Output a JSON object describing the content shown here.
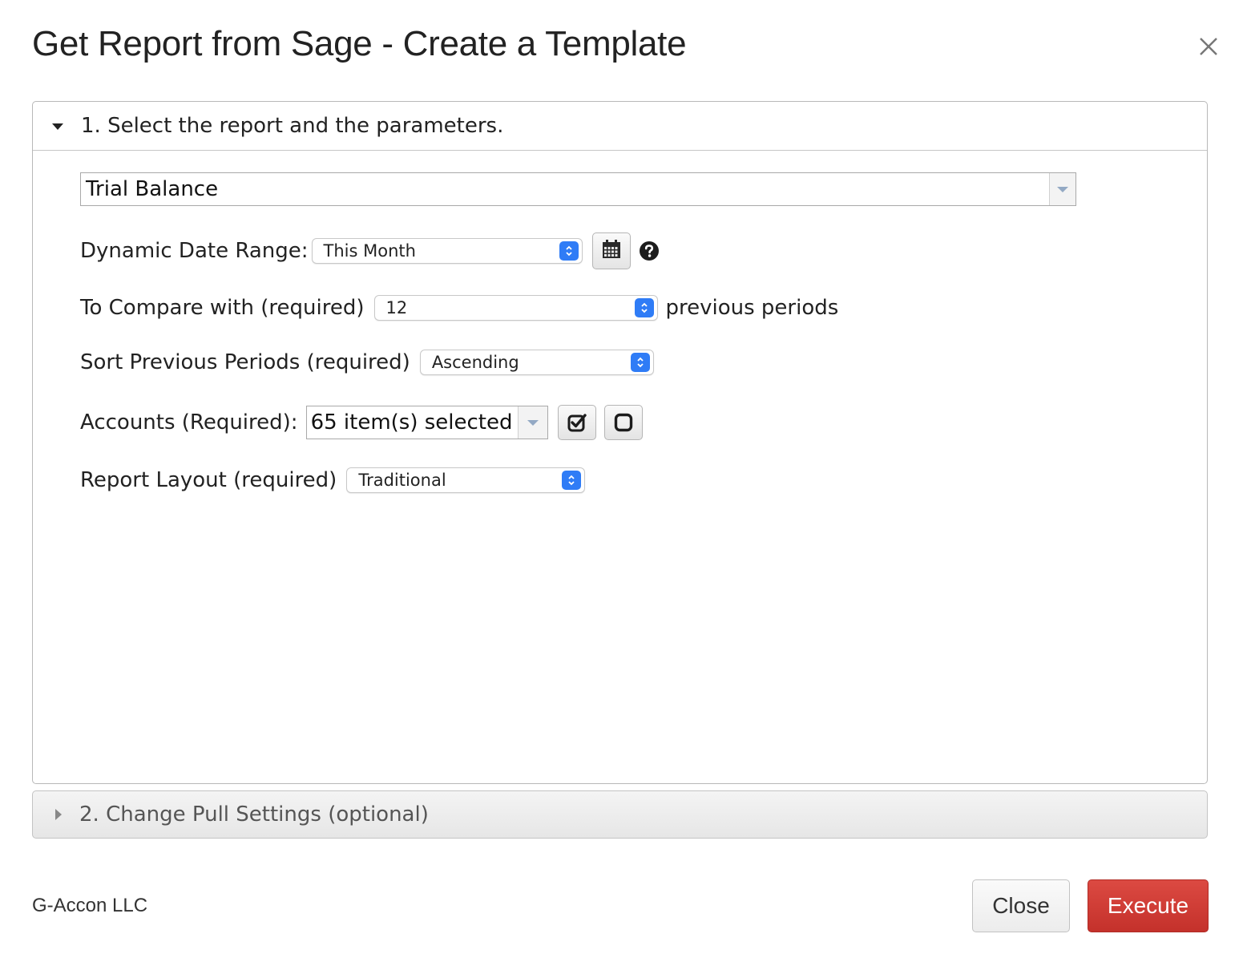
{
  "dialog": {
    "title": "Get Report from Sage - Create a Template"
  },
  "section1": {
    "header": "1. Select the report and the parameters.",
    "report": "Trial Balance",
    "date_range": {
      "label": "Dynamic Date Range:",
      "value": "This Month"
    },
    "compare": {
      "label": "To Compare with (required)",
      "value": "12",
      "suffix": "previous periods"
    },
    "sort": {
      "label": "Sort Previous Periods (required)",
      "value": "Ascending"
    },
    "accounts": {
      "label": "Accounts (Required):",
      "value": "65 item(s) selected"
    },
    "layout": {
      "label": "Report Layout (required)",
      "value": "Traditional"
    }
  },
  "section2": {
    "header": "2. Change Pull Settings (optional)"
  },
  "footer": {
    "brand": "G-Accon LLC",
    "close_label": "Close",
    "execute_label": "Execute"
  },
  "colors": {
    "accent_blue": "#2f7cf6",
    "execute_red": "#d03d36"
  },
  "icons": [
    "close-icon",
    "caret-down-icon",
    "caret-right-icon",
    "calendar-icon",
    "help-icon",
    "check-all-icon",
    "uncheck-all-icon",
    "stepper-icon"
  ]
}
